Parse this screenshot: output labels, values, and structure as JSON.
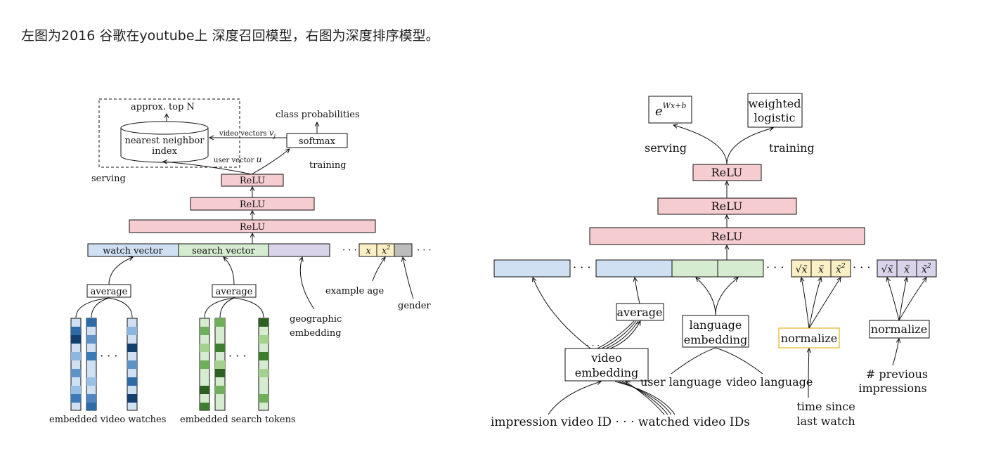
{
  "header": {
    "caption": "左图为2016 谷歌在youtube上 深度召回模型，右图为深度排序模型。"
  },
  "left": {
    "approx_top": "approx. top N",
    "nn_index_line1": "nearest neighbor",
    "nn_index_line2": "index",
    "class_probabilities": "class probabilities",
    "video_vectors": "video vectors",
    "video_vectors_sym": "v",
    "video_vectors_sub": "j",
    "softmax": "softmax",
    "user_vector": "user vector",
    "user_vector_sym": "u",
    "training": "training",
    "serving": "serving",
    "relu_top": "ReLU",
    "relu_mid": "ReLU",
    "relu_bottom": "ReLU",
    "watch_vector": "watch vector",
    "search_vector": "search vector",
    "x": "x",
    "x2": "x",
    "x2_exp": "2",
    "average_watch": "average",
    "average_search": "average",
    "example_age": "example age",
    "gender": "gender",
    "geo_line1": "geographic",
    "geo_line2": "embedding",
    "embedded_watches": "embedded video watches",
    "embedded_tokens": "embedded search tokens",
    "ellipsis": "· · ·"
  },
  "right": {
    "exp_base": "e",
    "exp_power": "Wx+b",
    "weighted_line1": "weighted",
    "weighted_line2": "logistic",
    "serving": "serving",
    "training": "training",
    "relu_top": "ReLU",
    "relu_mid": "ReLU",
    "relu_bottom": "ReLU",
    "average": "average",
    "language_line1": "language",
    "language_line2": "embedding",
    "normalize_yellow": "normalize",
    "normalize_purple": "normalize",
    "video_line1": "video",
    "video_line2": "embedding",
    "user_language": "user language",
    "video_language": "video language",
    "time_line1": "time since",
    "time_line2": "last watch",
    "prev_line1": "# previous",
    "prev_line2": "impressions",
    "impression_id": "impression video ID",
    "watched_ids": "watched video IDs",
    "ellipsis": "· · ·",
    "sqrt_x": "√x̃",
    "x_tilde": "x̃",
    "x_tilde_sq": "x̃",
    "sq_exp": "2"
  },
  "colors": {
    "relu": "#f5ccd0",
    "blue": "#cfe0f3",
    "green": "#d6ecd0",
    "purple": "#d9d4ea",
    "yellow": "#fbf0c5",
    "gray": "#bdbdbd",
    "norm_border": "#e8c44a"
  }
}
